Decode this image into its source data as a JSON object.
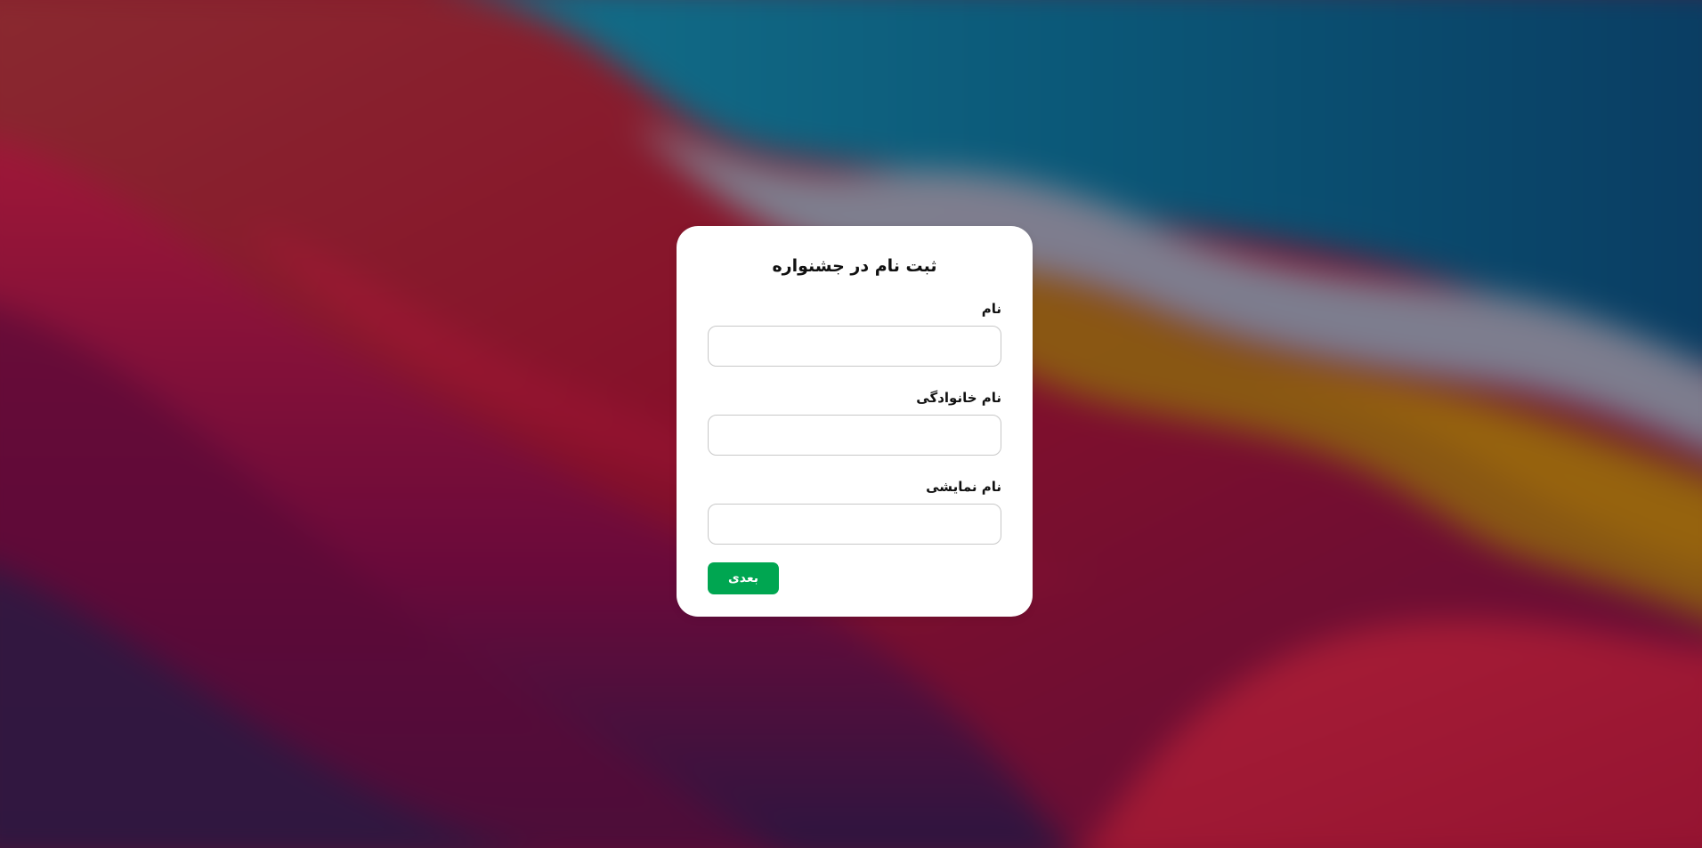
{
  "form": {
    "title": "ثبت نام در جشنواره",
    "fields": [
      {
        "label": "نام",
        "value": "",
        "placeholder": ""
      },
      {
        "label": "نام خانوادگی",
        "value": "",
        "placeholder": ""
      },
      {
        "label": "نام نمایشی",
        "value": "",
        "placeholder": ""
      }
    ],
    "next_button_label": "بعدی"
  },
  "colors": {
    "card_background": "#ffffff",
    "button_accent": "#00a651",
    "input_border": "#c8c8c8"
  }
}
